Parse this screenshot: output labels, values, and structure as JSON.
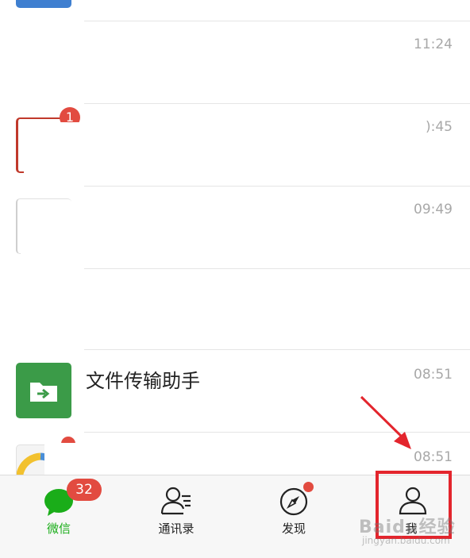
{
  "chat_list": {
    "items": [
      {
        "name": "",
        "time": ""
      },
      {
        "name": "",
        "time": "11:24"
      },
      {
        "name": "",
        "time": "):45",
        "unread": "1"
      },
      {
        "name": "",
        "time": "09:49"
      },
      {
        "name": "",
        "time": ""
      },
      {
        "name": "文件传输助手",
        "time": "08:51"
      },
      {
        "name": "",
        "time": "08:51"
      }
    ]
  },
  "tabbar": {
    "tabs": [
      {
        "label": "微信",
        "badge": "32",
        "icon": "chat-bubble-icon",
        "active": true
      },
      {
        "label": "通讯录",
        "icon": "contacts-icon"
      },
      {
        "label": "发现",
        "icon": "compass-icon",
        "dot": true
      },
      {
        "label": "我",
        "icon": "person-icon"
      }
    ]
  },
  "colors": {
    "accent": "#1aad19",
    "badge": "#e24b40",
    "highlight": "#e3252d",
    "file_helper": "#3b9b48"
  },
  "watermark": {
    "brand": "Baidu经验",
    "url": "jingyan.baidu.com"
  }
}
